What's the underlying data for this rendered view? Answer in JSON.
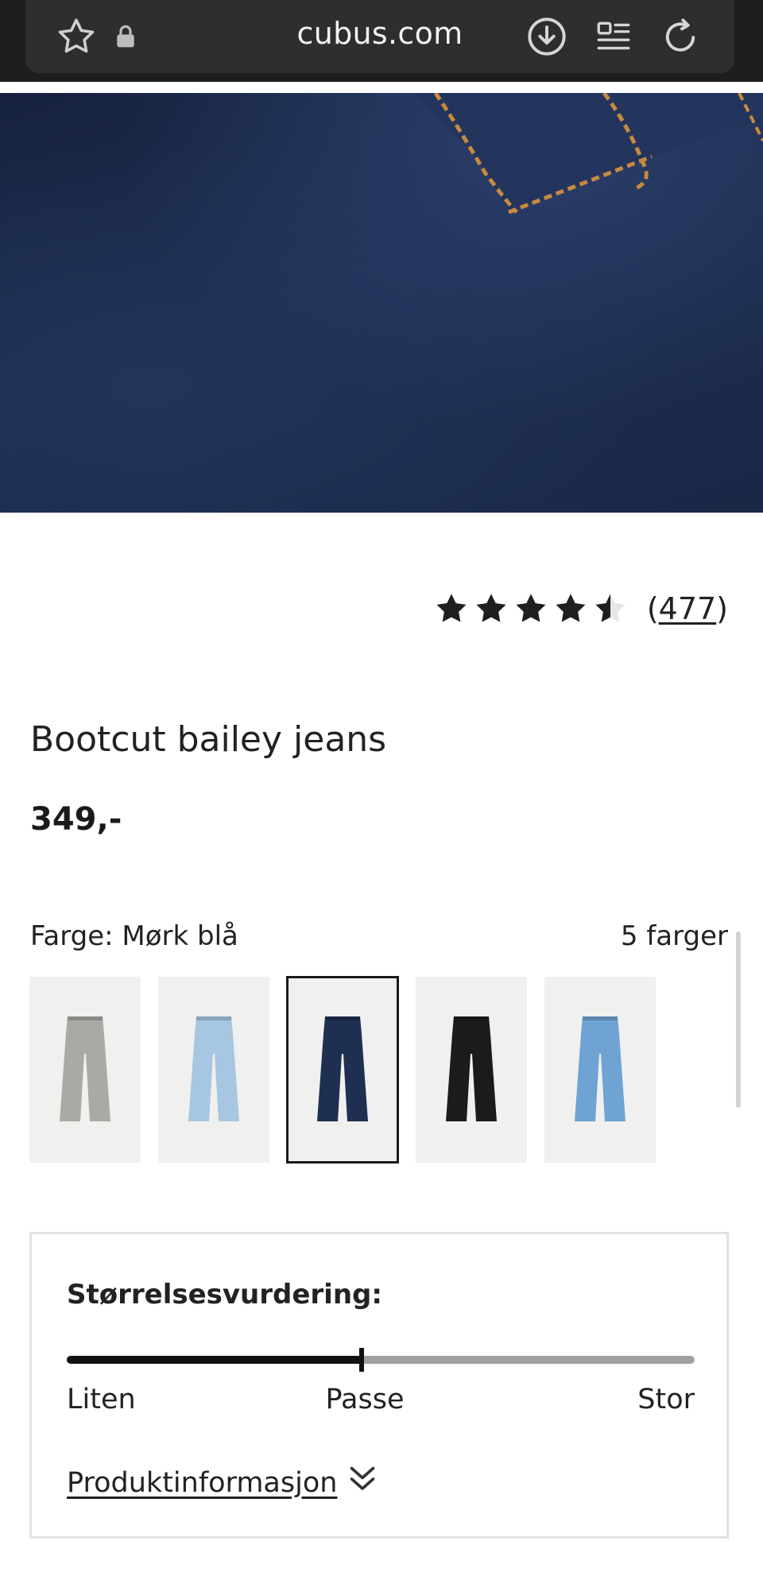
{
  "browser": {
    "url": "cubus.com",
    "icons": [
      "star-icon",
      "lock-icon",
      "download-icon",
      "reader-mode-icon",
      "reload-icon"
    ]
  },
  "carousel": {
    "slide_count": 6,
    "active_index": 5
  },
  "product": {
    "rating_value": 4.5,
    "rating_count": "477",
    "rating_open": "(",
    "rating_close": ")",
    "title": "Bootcut bailey jeans",
    "price": "349,-"
  },
  "colors": {
    "label": "Farge: Mørk blå",
    "count_label": "5 farger",
    "swatches": [
      {
        "name": "grey",
        "color": "#a9aaa6"
      },
      {
        "name": "light-blue",
        "color": "#a7c6e1"
      },
      {
        "name": "dark-blue",
        "color": "#1f2f52",
        "selected": true
      },
      {
        "name": "black",
        "color": "#1b1b1c"
      },
      {
        "name": "mid-blue",
        "color": "#6ea3d3"
      }
    ]
  },
  "size_assessment": {
    "heading": "Størrelsesvurdering:",
    "level": 0.47,
    "labels": {
      "small": "Liten",
      "fit": "Passe",
      "large": "Stor"
    },
    "product_info_link": "Produktinformasjon"
  }
}
